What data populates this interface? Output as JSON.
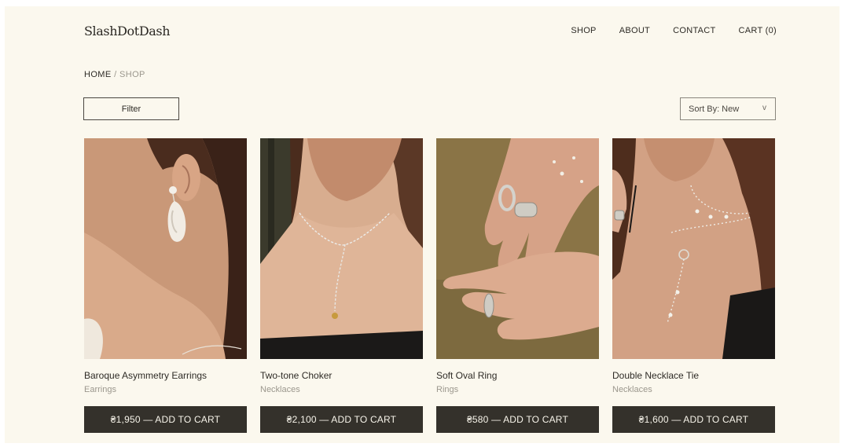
{
  "brand": {
    "logo_text": "SlashDotDash"
  },
  "nav": {
    "items": [
      {
        "label": "SHOP"
      },
      {
        "label": "ABOUT"
      },
      {
        "label": "CONTACT"
      },
      {
        "label": "CART (0)"
      }
    ]
  },
  "breadcrumb": {
    "home": "HOME",
    "separator": "/",
    "current": "SHOP"
  },
  "toolbar": {
    "filter_label": "Filter",
    "sort_label": "Sort By: New",
    "sort_chevron": "v"
  },
  "products": [
    {
      "name": "Baroque Asymmetry Earrings",
      "category": "Earrings",
      "button_label": "₴1,950 — ADD TO CART",
      "image_subject": "pearl drop earring on ear"
    },
    {
      "name": "Two-tone Choker",
      "category": "Necklaces",
      "button_label": "₴2,100 — ADD TO CART",
      "image_subject": "silver chain choker with gold bead"
    },
    {
      "name": "Soft Oval Ring",
      "category": "Rings",
      "button_label": "₴580 — ADD TO CART",
      "image_subject": "hands wearing silver rings"
    },
    {
      "name": "Double Necklace Tie",
      "category": "Necklaces",
      "button_label": "₴1,600 — ADD TO CART",
      "image_subject": "double pearl necklace with ring tie"
    }
  ],
  "colors": {
    "page_background": "#fbf8ee",
    "button_background": "#34312b",
    "button_text": "#f7f4ea",
    "muted_text": "#9b978d"
  }
}
